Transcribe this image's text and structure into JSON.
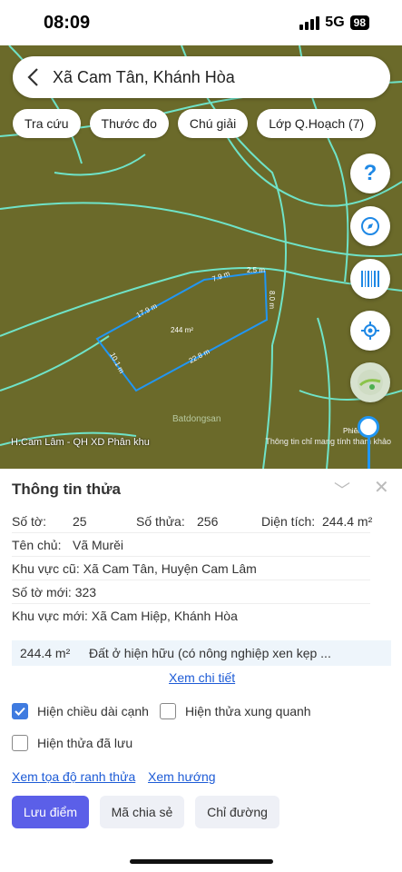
{
  "status": {
    "time": "08:09",
    "network": "5G",
    "battery": "98"
  },
  "search": {
    "query": "Xã Cam Tân, Khánh Hòa"
  },
  "chips": [
    "Tra cứu",
    "Thước đo",
    "Chú giải",
    "Lớp Q.Hoạch (7)"
  ],
  "map": {
    "edges": {
      "top": "7.9 m",
      "top_right": "2.5 m",
      "right": "8.0 m",
      "left_top": "17.9 m",
      "left": "10.1 m",
      "bottom": "22.8 m"
    },
    "area_label": "244 m²",
    "watermark": "Batdongsan",
    "left_label": "H.Cam Lâm - QH XD Phân khu",
    "note": "Thông tin chỉ mang tính tham khảo",
    "corner": "Phiên 1.1"
  },
  "panel": {
    "title": "Thông tin thửa",
    "so_to_label": "Số tờ:",
    "so_to": "25",
    "so_thua_label": "Số thửa:",
    "so_thua": "256",
    "dien_tich_label": "Diện tích:",
    "dien_tich": "244.4 m²",
    "ten_chu_label": "Tên chủ:",
    "ten_chu": "Vã Murěi",
    "kv_cu": "Khu vực cũ: Xã Cam Tân, Huyện Cam Lâm",
    "so_to_moi": "Số tờ mới: 323",
    "kv_moi": "Khu vực mới: Xã Cam Hiệp, Khánh Hòa",
    "land_area": "244.4 m²",
    "land_type": "Đất ở hiện hữu (có nông nghiệp xen kẹp ...",
    "detail_link": "Xem chi tiết",
    "cb_edges": "Hiện chiều dài cạnh",
    "cb_neighbors": "Hiện thửa xung quanh",
    "cb_saved": "Hiện thửa đã lưu",
    "link_coords": "Xem tọa độ ranh thửa",
    "link_direction": "Xem hướng",
    "btn_save": "Lưu điểm",
    "btn_share": "Mã chia sẻ",
    "btn_route": "Chỉ đường"
  }
}
